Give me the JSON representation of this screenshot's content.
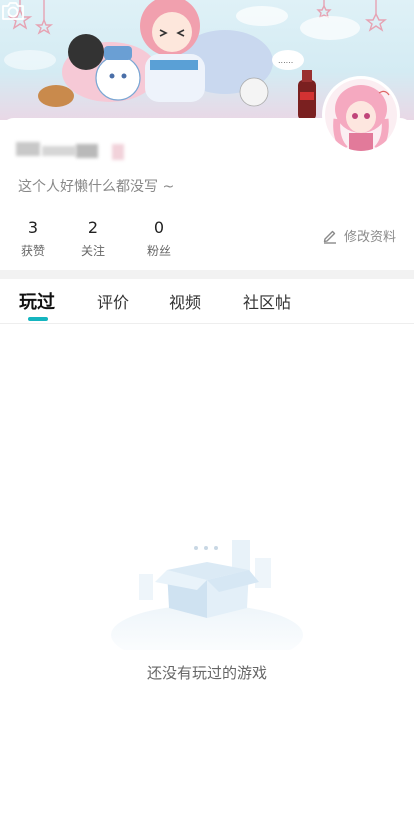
{
  "profile": {
    "signature": "这个人好懒什么都没写 ~",
    "stats": [
      {
        "value": "3",
        "label": "获赞"
      },
      {
        "value": "2",
        "label": "关注"
      },
      {
        "value": "0",
        "label": "粉丝"
      }
    ],
    "edit_label": "修改资料"
  },
  "tabs": [
    {
      "label": "玩过",
      "active": true
    },
    {
      "label": "评价",
      "active": false
    },
    {
      "label": "视频",
      "active": false
    },
    {
      "label": "社区帖",
      "active": false
    }
  ],
  "empty_state": {
    "message": "还没有玩过的游戏"
  },
  "colors": {
    "accent": "#15b5bf",
    "background": "#ffffff",
    "muted_text": "#888888"
  },
  "icons": {
    "camera": "camera-icon",
    "edit": "edit-pen-icon"
  }
}
